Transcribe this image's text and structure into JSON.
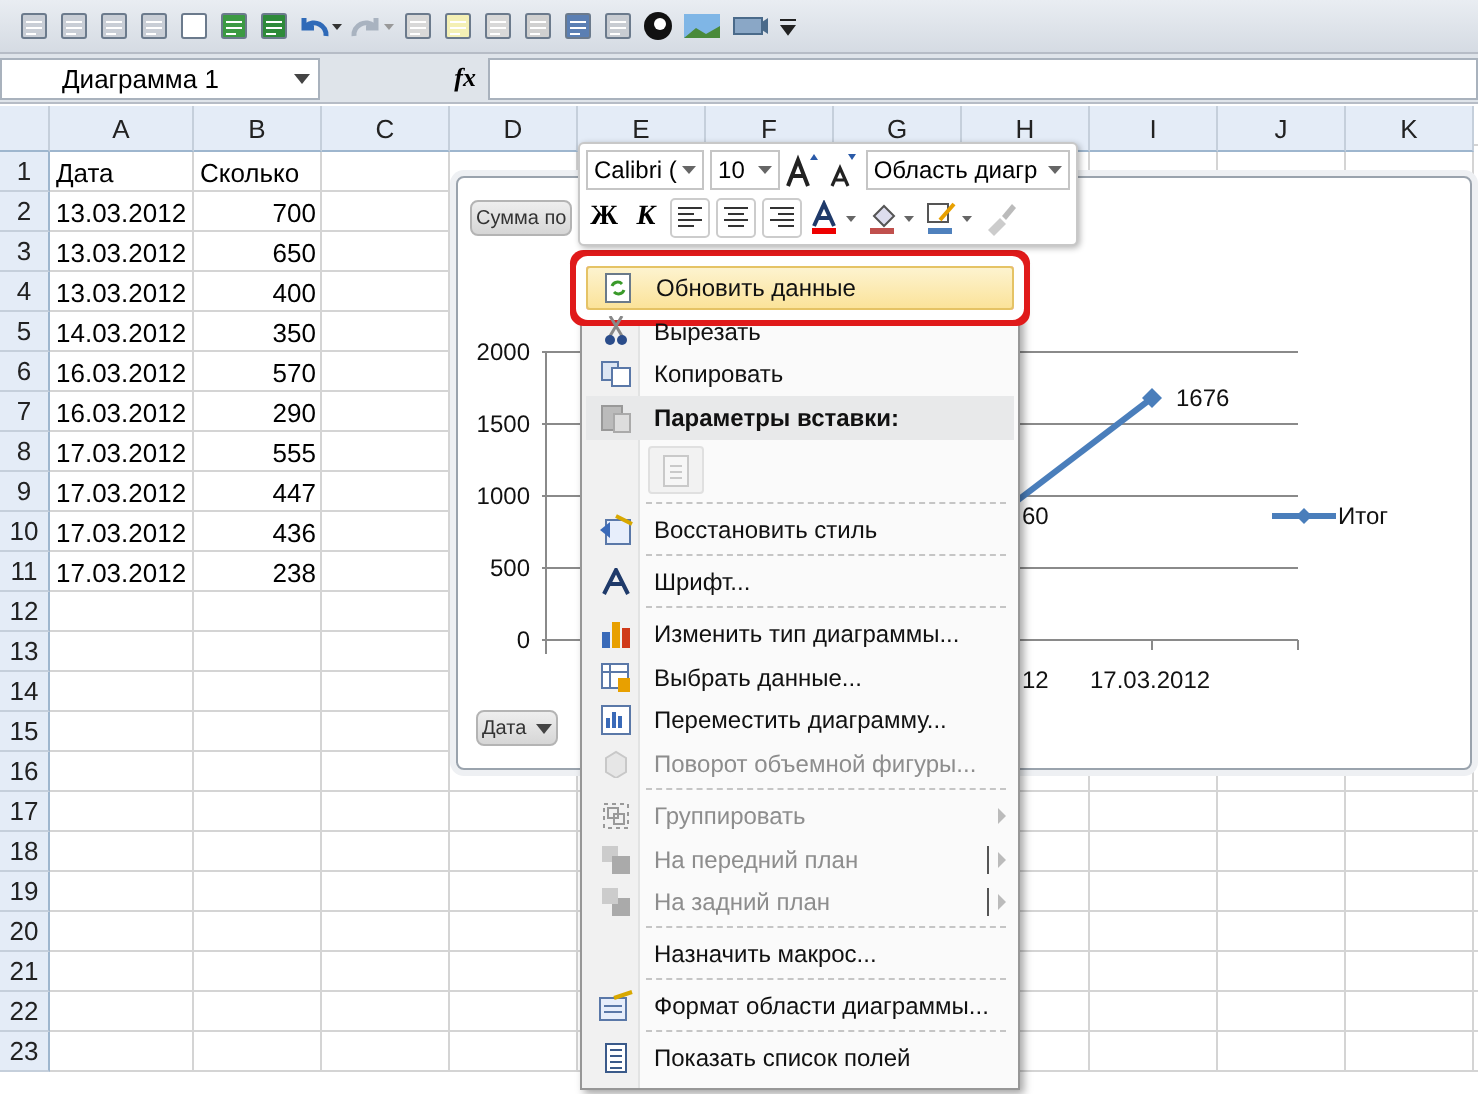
{
  "name_box": {
    "value": "Диаграмма 1"
  },
  "formula_bar": {
    "fx": "fx"
  },
  "columns": [
    "A",
    "B",
    "C",
    "D",
    "E",
    "F",
    "G",
    "H",
    "I",
    "J",
    "K"
  ],
  "rows": [
    {
      "number": "1",
      "cells": [
        "Дата",
        "Сколько"
      ]
    },
    {
      "number": "2",
      "cells": [
        "13.03.2012",
        "700"
      ]
    },
    {
      "number": "3",
      "cells": [
        "13.03.2012",
        "650"
      ]
    },
    {
      "number": "4",
      "cells": [
        "13.03.2012",
        "400"
      ]
    },
    {
      "number": "5",
      "cells": [
        "14.03.2012",
        "350"
      ]
    },
    {
      "number": "6",
      "cells": [
        "16.03.2012",
        "570"
      ]
    },
    {
      "number": "7",
      "cells": [
        "16.03.2012",
        "290"
      ]
    },
    {
      "number": "8",
      "cells": [
        "17.03.2012",
        "555"
      ]
    },
    {
      "number": "9",
      "cells": [
        "17.03.2012",
        "447"
      ]
    },
    {
      "number": "10",
      "cells": [
        "17.03.2012",
        "436"
      ]
    },
    {
      "number": "11",
      "cells": [
        "17.03.2012",
        "238"
      ]
    },
    {
      "number": "12",
      "cells": []
    },
    {
      "number": "13",
      "cells": []
    },
    {
      "number": "14",
      "cells": []
    },
    {
      "number": "15",
      "cells": []
    },
    {
      "number": "16",
      "cells": []
    },
    {
      "number": "17",
      "cells": []
    },
    {
      "number": "18",
      "cells": []
    },
    {
      "number": "19",
      "cells": []
    },
    {
      "number": "20",
      "cells": []
    },
    {
      "number": "21",
      "cells": []
    },
    {
      "number": "22",
      "cells": []
    },
    {
      "number": "23",
      "cells": []
    }
  ],
  "chart": {
    "value_field_button": "Сумма по",
    "axis_field_button": "Дата",
    "y_ticks": [
      "2000",
      "1500",
      "1000",
      "500",
      "0"
    ],
    "x_labels": [
      "12",
      "17.03.2012"
    ],
    "data_labels": [
      "60",
      "1676"
    ],
    "legend": "Итог"
  },
  "mini_toolbar": {
    "font": "Calibri (",
    "size": "10",
    "element": "Область диагр",
    "bold": "Ж",
    "italic": "К"
  },
  "context_menu": [
    {
      "label": "Обновить данные",
      "kind": "item",
      "selected": true,
      "disabled": false,
      "submenu": false,
      "separator_before": false
    },
    {
      "label": "Вырезать",
      "kind": "item",
      "selected": false,
      "disabled": false,
      "submenu": false,
      "separator_before": false
    },
    {
      "label": "Копировать",
      "kind": "item",
      "selected": false,
      "disabled": false,
      "submenu": false,
      "separator_before": false
    },
    {
      "label": "Параметры вставки:",
      "kind": "header",
      "selected": false,
      "disabled": false,
      "submenu": false,
      "separator_before": false
    },
    {
      "kind": "paste",
      "selected": false,
      "disabled": true,
      "submenu": false,
      "separator_before": false
    },
    {
      "label": "Восстановить стиль",
      "kind": "item",
      "selected": false,
      "disabled": false,
      "submenu": false,
      "separator_before": true
    },
    {
      "label": "Шрифт...",
      "kind": "item",
      "selected": false,
      "disabled": false,
      "submenu": false,
      "separator_before": true
    },
    {
      "label": "Изменить тип диаграммы...",
      "kind": "item",
      "selected": false,
      "disabled": false,
      "submenu": false,
      "separator_before": true
    },
    {
      "label": "Выбрать данные...",
      "kind": "item",
      "selected": false,
      "disabled": false,
      "submenu": false,
      "separator_before": false
    },
    {
      "label": "Переместить диаграмму...",
      "kind": "item",
      "selected": false,
      "disabled": false,
      "submenu": false,
      "separator_before": false
    },
    {
      "label": "Поворот объемной фигуры...",
      "kind": "item",
      "selected": false,
      "disabled": true,
      "submenu": false,
      "separator_before": false
    },
    {
      "label": "Группировать",
      "kind": "item",
      "selected": false,
      "disabled": true,
      "submenu": true,
      "separator_before": true
    },
    {
      "label": "На передний план",
      "kind": "split",
      "selected": false,
      "disabled": true,
      "submenu": true,
      "separator_before": false
    },
    {
      "label": "На задний план",
      "kind": "split",
      "selected": false,
      "disabled": true,
      "submenu": true,
      "separator_before": false
    },
    {
      "label": "Назначить макрос...",
      "kind": "item",
      "selected": false,
      "disabled": false,
      "submenu": false,
      "separator_before": true
    },
    {
      "label": "Формат области диаграммы...",
      "kind": "item",
      "selected": false,
      "disabled": false,
      "submenu": false,
      "separator_before": true
    },
    {
      "label": "Показать список полей",
      "kind": "item",
      "selected": false,
      "disabled": false,
      "submenu": false,
      "separator_before": true
    }
  ]
}
